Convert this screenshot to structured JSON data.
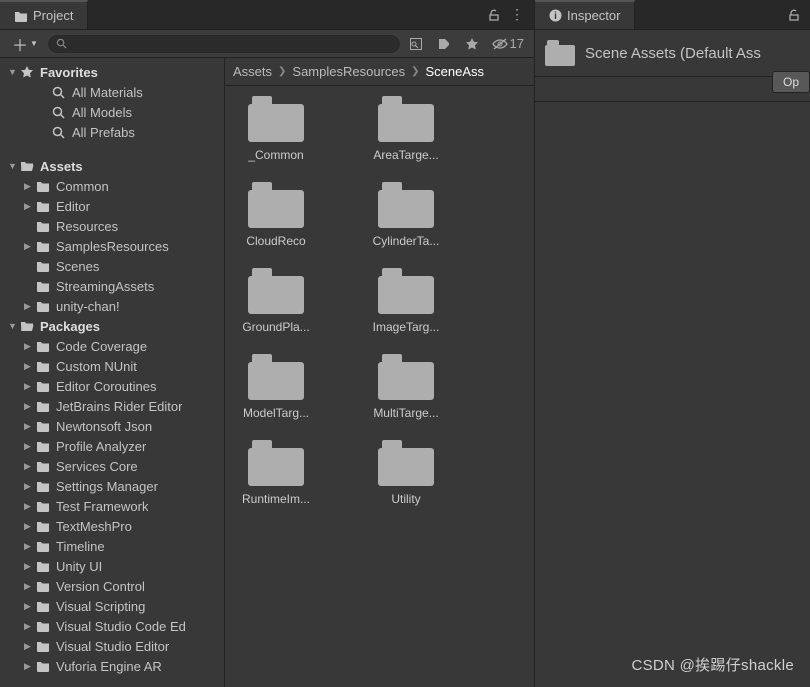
{
  "project": {
    "tab_label": "Project",
    "hidden_count": "17",
    "search_placeholder": ""
  },
  "inspector": {
    "tab_label": "Inspector",
    "asset_title": "Scene Assets (Default Ass",
    "open_btn": "Op"
  },
  "favorites": {
    "label": "Favorites",
    "items": [
      "All Materials",
      "All Models",
      "All Prefabs"
    ]
  },
  "assets": {
    "label": "Assets",
    "items": [
      {
        "label": "Common",
        "arrow": true
      },
      {
        "label": "Editor",
        "arrow": true
      },
      {
        "label": "Resources",
        "arrow": false
      },
      {
        "label": "SamplesResources",
        "arrow": true
      },
      {
        "label": "Scenes",
        "arrow": false
      },
      {
        "label": "StreamingAssets",
        "arrow": false
      },
      {
        "label": "unity-chan!",
        "arrow": true
      }
    ]
  },
  "packages": {
    "label": "Packages",
    "items": [
      "Code Coverage",
      "Custom NUnit",
      "Editor Coroutines",
      "JetBrains Rider Editor",
      "Newtonsoft Json",
      "Profile Analyzer",
      "Services Core",
      "Settings Manager",
      "Test Framework",
      "TextMeshPro",
      "Timeline",
      "Unity UI",
      "Version Control",
      "Visual Scripting",
      "Visual Studio Code Ed",
      "Visual Studio Editor",
      "Vuforia Engine AR"
    ]
  },
  "breadcrumb": [
    "Assets",
    "SamplesResources",
    "SceneAss"
  ],
  "grid_items": [
    "_Common",
    "AreaTarge...",
    "CloudReco",
    "CylinderTa...",
    "GroundPla...",
    "ImageTarg...",
    "ModelTarg...",
    "MultiTarge...",
    "RuntimeIm...",
    "Utility"
  ],
  "watermark": "CSDN @挨踢仔shackle"
}
